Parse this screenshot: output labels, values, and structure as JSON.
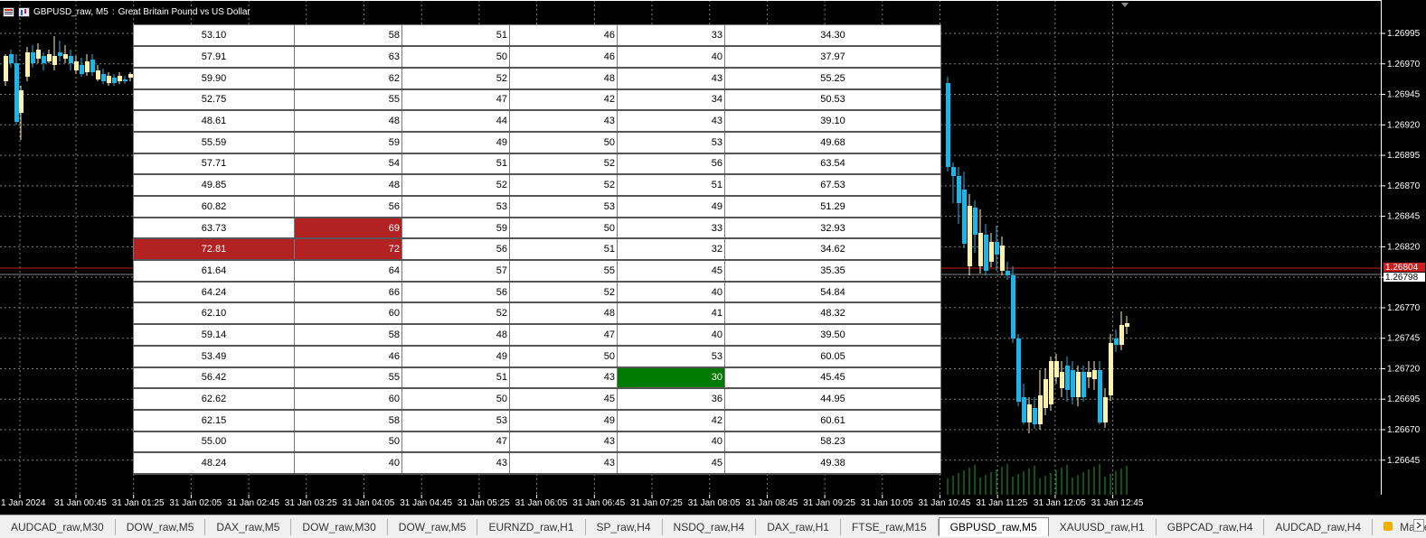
{
  "window": {
    "symbol": "GBPUSD_raw, M5",
    "description": "Great Britain Pound vs US Dollar"
  },
  "colors": {
    "background": "#000000",
    "grid": "#7f7f7f",
    "bull_candle": "#fff2b0",
    "bear_candle": "#1fb3e8",
    "price_line": "#c81e1e",
    "red_cell": "#b22222",
    "green_cell": "#007a00"
  },
  "price_axis": {
    "labels": [
      "1.26995",
      "1.26970",
      "1.26945",
      "1.26920",
      "1.26895",
      "1.26870",
      "1.26845",
      "1.26820",
      "1.26795",
      "1.26770",
      "1.26745",
      "1.26720",
      "1.26695",
      "1.26670",
      "1.26645"
    ],
    "current_price_red": "1.26804",
    "current_price": "1.26798"
  },
  "time_axis": {
    "labels": [
      "1 Jan 2024",
      "31 Jan 00:45",
      "31 Jan 01:25",
      "31 Jan 02:05",
      "31 Jan 02:45",
      "31 Jan 03:25",
      "31 Jan 04:05",
      "31 Jan 04:45",
      "31 Jan 05:25",
      "31 Jan 06:05",
      "31 Jan 06:45",
      "31 Jan 07:25",
      "31 Jan 08:05",
      "31 Jan 08:45",
      "31 Jan 09:25",
      "31 Jan 10:05",
      "31 Jan 10:45",
      "31 Jan 11:25",
      "31 Jan 12:05",
      "31 Jan 12:45"
    ]
  },
  "table": {
    "rows": [
      {
        "cells": [
          "53.10",
          "58",
          "51",
          "46",
          "33",
          "34.30"
        ],
        "highlight": []
      },
      {
        "cells": [
          "57.91",
          "63",
          "50",
          "46",
          "40",
          "37.97"
        ],
        "highlight": []
      },
      {
        "cells": [
          "59.90",
          "62",
          "52",
          "48",
          "43",
          "55.25"
        ],
        "highlight": []
      },
      {
        "cells": [
          "52.75",
          "55",
          "47",
          "42",
          "34",
          "50.53"
        ],
        "highlight": []
      },
      {
        "cells": [
          "48.61",
          "48",
          "44",
          "43",
          "43",
          "39.10"
        ],
        "highlight": []
      },
      {
        "cells": [
          "55.59",
          "59",
          "49",
          "50",
          "53",
          "49.68"
        ],
        "highlight": []
      },
      {
        "cells": [
          "57.71",
          "54",
          "51",
          "52",
          "56",
          "63.54"
        ],
        "highlight": []
      },
      {
        "cells": [
          "49.85",
          "48",
          "52",
          "52",
          "51",
          "67.53"
        ],
        "highlight": []
      },
      {
        "cells": [
          "60.82",
          "56",
          "53",
          "53",
          "49",
          "51.29"
        ],
        "highlight": []
      },
      {
        "cells": [
          "63.73",
          "69",
          "59",
          "50",
          "33",
          "32.93"
        ],
        "highlight": [
          {
            "col": 1,
            "color": "red"
          }
        ]
      },
      {
        "cells": [
          "72.81",
          "72",
          "56",
          "51",
          "32",
          "34.62"
        ],
        "highlight": [
          {
            "col": 0,
            "color": "red"
          },
          {
            "col": 1,
            "color": "red"
          }
        ]
      },
      {
        "cells": [
          "61.64",
          "64",
          "57",
          "55",
          "45",
          "35.35"
        ],
        "highlight": []
      },
      {
        "cells": [
          "64.24",
          "66",
          "56",
          "52",
          "40",
          "54.84"
        ],
        "highlight": []
      },
      {
        "cells": [
          "62.10",
          "60",
          "52",
          "48",
          "41",
          "48.32"
        ],
        "highlight": []
      },
      {
        "cells": [
          "59.14",
          "58",
          "48",
          "47",
          "40",
          "39.50"
        ],
        "highlight": []
      },
      {
        "cells": [
          "53.49",
          "46",
          "49",
          "50",
          "53",
          "60.05"
        ],
        "highlight": []
      },
      {
        "cells": [
          "56.42",
          "55",
          "51",
          "43",
          "30",
          "45.45"
        ],
        "highlight": [
          {
            "col": 4,
            "color": "green"
          }
        ]
      },
      {
        "cells": [
          "62.62",
          "60",
          "50",
          "45",
          "36",
          "44.95"
        ],
        "highlight": []
      },
      {
        "cells": [
          "62.15",
          "58",
          "53",
          "49",
          "42",
          "60.61"
        ],
        "highlight": []
      },
      {
        "cells": [
          "55.00",
          "50",
          "47",
          "43",
          "40",
          "58.23"
        ],
        "highlight": []
      },
      {
        "cells": [
          "48.24",
          "40",
          "43",
          "43",
          "45",
          "49.38"
        ],
        "highlight": []
      }
    ]
  },
  "tabs": [
    {
      "label": "AUDCAD_raw,M30",
      "active": false
    },
    {
      "label": "DOW_raw,M5",
      "active": false
    },
    {
      "label": "DAX_raw,M5",
      "active": false
    },
    {
      "label": "DOW_raw,M30",
      "active": false
    },
    {
      "label": "DOW_raw,M5",
      "active": false
    },
    {
      "label": "EURNZD_raw,H1",
      "active": false
    },
    {
      "label": "SP_raw,H4",
      "active": false
    },
    {
      "label": "NSDQ_raw,H4",
      "active": false
    },
    {
      "label": "DAX_raw,H1",
      "active": false
    },
    {
      "label": "FTSE_raw,M15",
      "active": false
    },
    {
      "label": "GBPUSD_raw,M5",
      "active": true
    },
    {
      "label": "XAUUSD_raw,H1",
      "active": false
    },
    {
      "label": "GBPCAD_raw,H4",
      "active": false
    },
    {
      "label": "AUDCAD_raw,H4",
      "active": false
    },
    {
      "label": "Market",
      "active": false,
      "icon": "lock-icon"
    }
  ],
  "tab_scroll_icon": "chevron-right-icon"
}
